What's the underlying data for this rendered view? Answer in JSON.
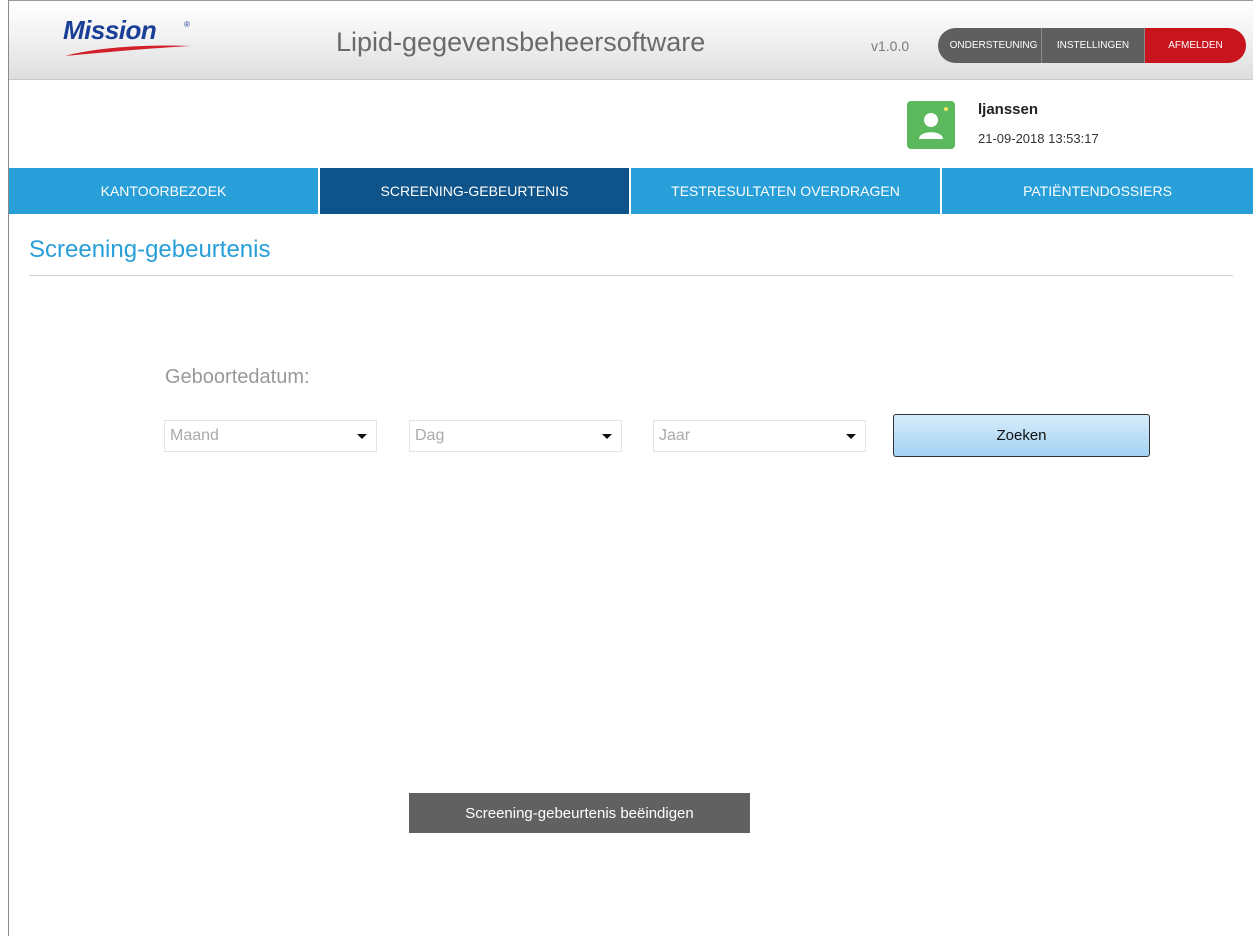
{
  "header": {
    "logo_text": "Mission",
    "logo_reg": "®",
    "app_title": "Lipid-gegevensbeheersoftware",
    "version": "v1.0.0",
    "buttons": {
      "support": "ONDERSTEUNING",
      "settings": "INSTELLINGEN",
      "logout": "AFMELDEN"
    },
    "colors": {
      "logo": "#1a3f96",
      "logout": "#c8141c",
      "button": "#5f5f5f"
    }
  },
  "user": {
    "icon": "user-avatar-icon",
    "name": "ljanssen",
    "datetime": "21-09-2018 13:53:17",
    "avatar_color": "#5cb85c"
  },
  "nav": {
    "tabs": [
      {
        "label": "KANTOORBEZOEK",
        "active": false
      },
      {
        "label": "SCREENING-GEBEURTENIS",
        "active": true
      },
      {
        "label": "TESTRESULTATEN OVERDRAGEN",
        "active": false
      },
      {
        "label": "PATIËNTENDOSSIERS",
        "active": false
      }
    ],
    "colors": {
      "tab": "#299fd9",
      "active": "#0e5389"
    }
  },
  "main": {
    "title": "Screening-gebeurtenis",
    "dob_label": "Geboortedatum:",
    "month_value": "Maand",
    "day_value": "Dag",
    "year_value": "Jaar",
    "search_label": "Zoeken",
    "end_label": "Screening-gebeurtenis beëindigen"
  }
}
